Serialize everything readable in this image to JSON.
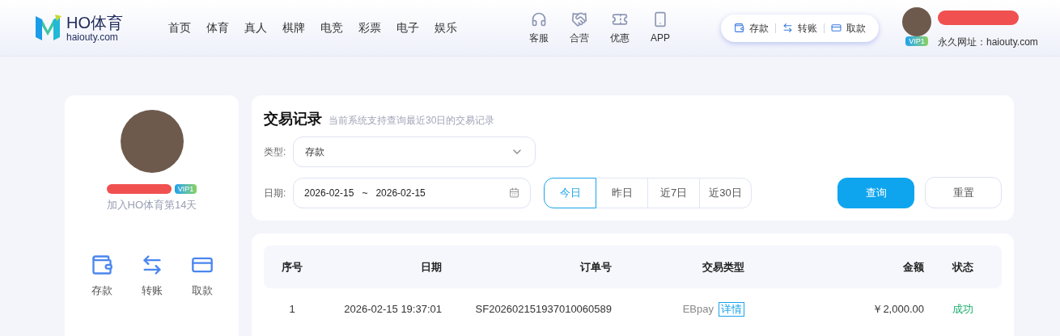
{
  "header": {
    "logo": {
      "name": "HO体育",
      "domain": "haiouty.com"
    },
    "nav": [
      {
        "label": "首页"
      },
      {
        "label": "体育"
      },
      {
        "label": "真人"
      },
      {
        "label": "棋牌"
      },
      {
        "label": "电竞"
      },
      {
        "label": "彩票"
      },
      {
        "label": "电子"
      },
      {
        "label": "娱乐"
      }
    ],
    "services": [
      {
        "kind": "support",
        "label": "客服"
      },
      {
        "kind": "partner",
        "label": "合营"
      },
      {
        "kind": "promo",
        "label": "优惠"
      },
      {
        "kind": "app",
        "label": "APP"
      }
    ],
    "wallet_actions": [
      {
        "kind": "deposit",
        "label": "存款"
      },
      {
        "kind": "transfer",
        "label": "转账"
      },
      {
        "kind": "withdraw",
        "label": "取款"
      }
    ],
    "user": {
      "vip": "VIP1",
      "permanent_url": "永久网址：haiouty.com"
    }
  },
  "profile": {
    "vip": "VIP1",
    "joined": "加入HO体育第14天",
    "actions": [
      {
        "kind": "deposit",
        "label": "存款"
      },
      {
        "kind": "transfer",
        "label": "转账"
      },
      {
        "kind": "withdraw",
        "label": "取款"
      }
    ]
  },
  "records": {
    "title": "交易记录",
    "subtitle": "当前系统支持查询最近30日的交易记录",
    "type_filter": {
      "label": "类型:",
      "value": "存款"
    },
    "date_filter": {
      "label": "日期:",
      "start": "2026-02-15",
      "separator": "~",
      "end": "2026-02-15"
    },
    "ranges": [
      {
        "label": "今日",
        "selected": true
      },
      {
        "label": "昨日",
        "selected": false
      },
      {
        "label": "近7日",
        "selected": false
      },
      {
        "label": "近30日",
        "selected": false
      }
    ],
    "buttons": {
      "query": "查询",
      "reset": "重置"
    }
  },
  "table": {
    "columns": [
      "序号",
      "日期",
      "订单号",
      "交易类型",
      "金额",
      "状态"
    ],
    "rows": [
      {
        "index": "1",
        "date": "2026-02-15 19:37:01",
        "order": "SF202602151937010060589",
        "method": "EBpay",
        "detail": "详情",
        "amount": "￥2,000.00",
        "status": "成功",
        "kind": "success"
      }
    ]
  }
}
